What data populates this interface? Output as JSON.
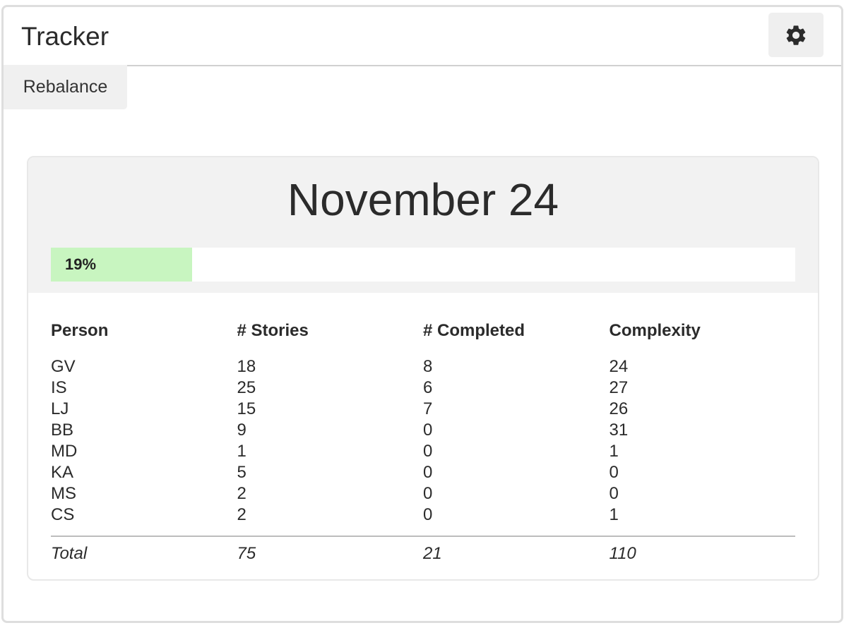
{
  "header": {
    "title": "Tracker",
    "settings_icon": "gear-icon"
  },
  "toolbar": {
    "rebalance_label": "Rebalance"
  },
  "card": {
    "date": "November 24",
    "progress": {
      "label": "19%",
      "value": 0.19,
      "fill_color": "#c8f5c0"
    },
    "table": {
      "columns": [
        "Person",
        "# Stories",
        "# Completed",
        "Complexity"
      ],
      "rows": [
        [
          "GV",
          "18",
          "8",
          "24"
        ],
        [
          "IS",
          "25",
          "6",
          "27"
        ],
        [
          "LJ",
          "15",
          "7",
          "26"
        ],
        [
          "BB",
          "9",
          "0",
          "31"
        ],
        [
          "MD",
          "1",
          "0",
          "1"
        ],
        [
          "KA",
          "5",
          "0",
          "0"
        ],
        [
          "MS",
          "2",
          "0",
          "0"
        ],
        [
          "CS",
          "2",
          "0",
          "1"
        ]
      ],
      "total": [
        "Total",
        "75",
        "21",
        "110"
      ]
    }
  }
}
